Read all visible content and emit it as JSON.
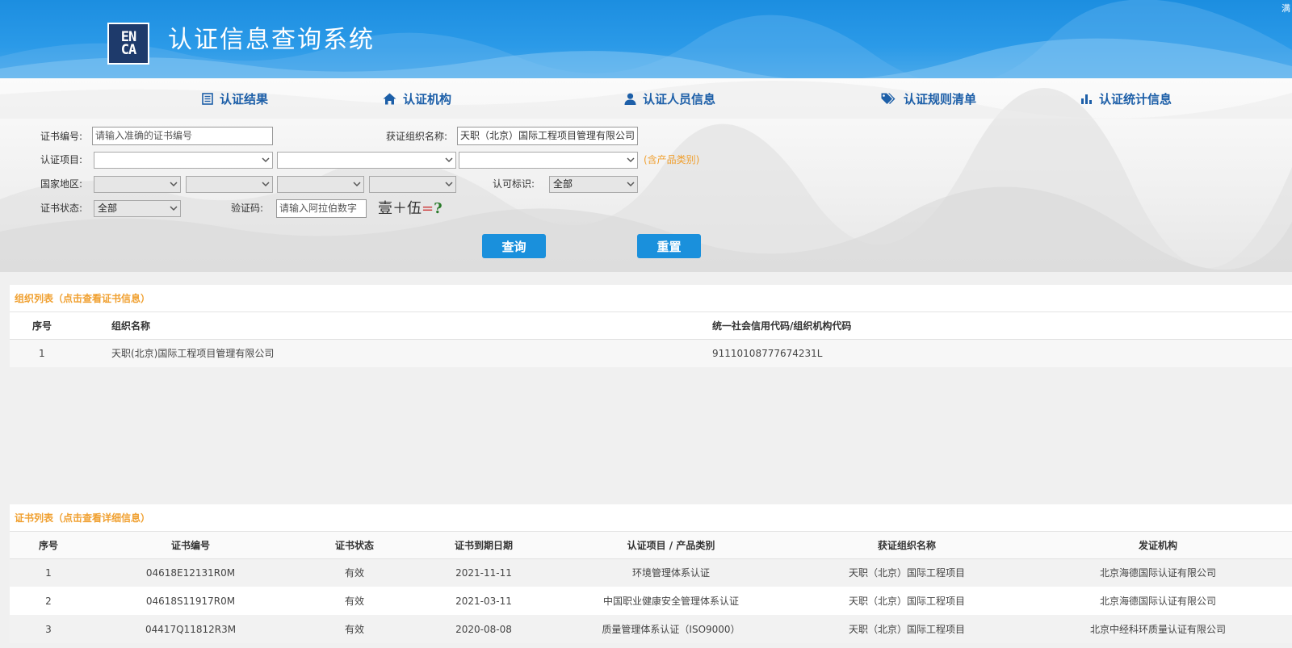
{
  "header": {
    "logo_text_top": "EN",
    "logo_text_bottom": "CA",
    "title": "认证信息查询系统",
    "corner_char": "满"
  },
  "nav": [
    {
      "label": "认证结果",
      "icon": "list-icon"
    },
    {
      "label": "认证机构",
      "icon": "home-icon"
    },
    {
      "label": "认证人员信息",
      "icon": "user-icon"
    },
    {
      "label": "认证规则清单",
      "icon": "tags-icon"
    },
    {
      "label": "认证统计信息",
      "icon": "bar-chart-icon"
    }
  ],
  "form": {
    "cert_no_label": "证书编号:",
    "cert_no_placeholder": "请输入准确的证书编号",
    "org_name_label": "获证组织名称:",
    "org_name_value": "天职（北京）国际工程项目管理有限公司",
    "project_label": "认证项目:",
    "project_hint": "(含产品类别)",
    "region_label": "国家地区:",
    "license_label": "认可标识:",
    "license_value": "全部",
    "status_label": "证书状态:",
    "status_value": "全部",
    "captcha_label": "验证码:",
    "captcha_placeholder": "请输入阿拉伯数字",
    "captcha_expr": "壹＋伍",
    "captcha_eq": "=",
    "captcha_q": "?",
    "query_button": "查询",
    "reset_button": "重置"
  },
  "org_list": {
    "title": "组织列表（点击查看证书信息）",
    "columns": [
      "序号",
      "组织名称",
      "统一社会信用代码/组织机构代码"
    ],
    "rows": [
      [
        "1",
        "天职(北京)国际工程项目管理有限公司",
        "91110108777674231L"
      ]
    ]
  },
  "cert_list": {
    "title": "证书列表（点击查看详细信息）",
    "columns": [
      "序号",
      "证书编号",
      "证书状态",
      "证书到期日期",
      "认证项目 / 产品类别",
      "获证组织名称",
      "发证机构"
    ],
    "rows": [
      [
        "1",
        "04618E12131R0M",
        "有效",
        "2021-11-11",
        "环境管理体系认证",
        "天职（北京）国际工程项目",
        "北京海德国际认证有限公司"
      ],
      [
        "2",
        "04618S11917R0M",
        "有效",
        "2021-03-11",
        "中国职业健康安全管理体系认证",
        "天职（北京）国际工程项目",
        "北京海德国际认证有限公司"
      ],
      [
        "3",
        "04417Q11812R3M",
        "有效",
        "2020-08-08",
        "质量管理体系认证（ISO9000）",
        "天职（北京）国际工程项目",
        "北京中经科环质量认证有限公司"
      ]
    ]
  },
  "colors": {
    "header_blue": "#1c8ee0",
    "nav_text": "#1d5fa8",
    "button_blue": "#1a90dc",
    "panel_title_orange": "#f0a030"
  }
}
